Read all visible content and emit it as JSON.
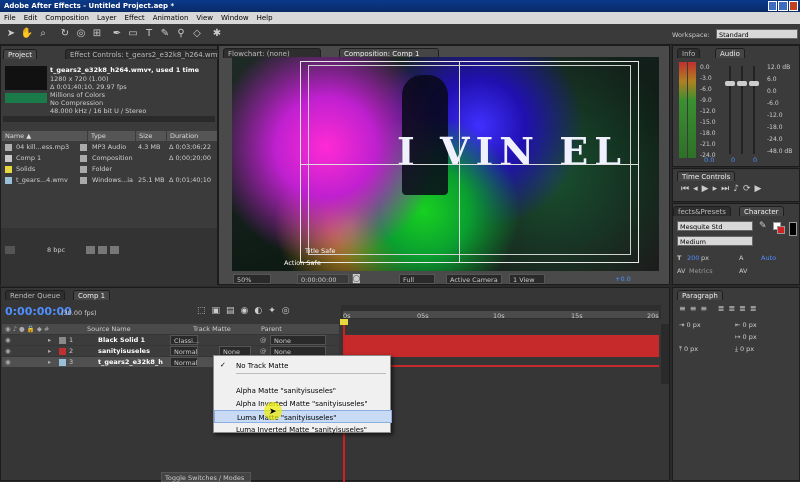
{
  "window": {
    "title": "Adobe After Effects - Untitled Project.aep *"
  },
  "menu": [
    "File",
    "Edit",
    "Composition",
    "Layer",
    "Effect",
    "Animation",
    "View",
    "Window",
    "Help"
  ],
  "workspace": {
    "label": "Workspace:",
    "value": "Standard"
  },
  "project": {
    "tab": "Project",
    "effect_tab": "Effect Controls: t_gears2_e32k8_h264.wmv",
    "name": "t_gears2_e32k8_h264.wmv▾, used 1 time",
    "info": [
      "1280 x 720 (1.00)",
      "Δ 0;01;40;10, 29.97 fps",
      "Millions of Colors",
      "No Compression",
      "48.000 kHz / 16 bit U / Stereo"
    ],
    "headers": {
      "name": "Name",
      "type": "Type",
      "size": "Size",
      "duration": "Duration"
    },
    "items": [
      {
        "name": "04 kill...ess.mp3",
        "type": "MP3 Audio",
        "size": "4.3 MB",
        "duration": "Δ 0;03;06;22",
        "color": "#b0b0b0"
      },
      {
        "name": "Comp 1",
        "type": "Composition",
        "size": "",
        "duration": "Δ 0;00;20;00",
        "color": "#c8c8c8"
      },
      {
        "name": "Solids",
        "type": "Folder",
        "size": "",
        "duration": "",
        "color": "#e6d840"
      },
      {
        "name": "t_gears...4.wmv",
        "type": "Windows...ia",
        "size": "25.1 MB",
        "duration": "Δ 0;01;40;10",
        "color": "#9ac0d8"
      }
    ],
    "bpc": "8 bpc"
  },
  "viewer": {
    "flowchart_tab": "Flowchart: (none)",
    "comp_tab": "Composition: Comp 1",
    "title_safe": "Title Safe",
    "action_safe": "Action Safe",
    "comp_text": "I VIN EL",
    "zoom": "50%",
    "timecode": "0:00:00:00",
    "resolution": "Full",
    "camera": "Active Camera",
    "views": "1 View",
    "exposure": "+0.0"
  },
  "info": {
    "tab": "Info",
    "audio_tab": "Audio"
  },
  "audio": {
    "db": [
      "0.0",
      "-3.0",
      "-6.0",
      "-9.0",
      "-12.0",
      "-15.0",
      "-18.0",
      "-21.0",
      "-24.0"
    ],
    "db_right": [
      "12.0 dB",
      "6.0",
      "0.0",
      "-6.0",
      "-12.0",
      "-18.0",
      "-24.0",
      "-48.0 dB"
    ],
    "left_val": "0.0",
    "mid_val": "0",
    "right_val": "0"
  },
  "time_controls": {
    "tab": "Time Controls"
  },
  "effects": {
    "tab": "fects&Presets",
    "character_tab": "Character",
    "font": "Mesquite Std",
    "style": "Medium",
    "size": "200",
    "size_unit": "px",
    "leading": "Auto",
    "kerning": "Metrics"
  },
  "paragraph": {
    "tab": "Paragraph",
    "values": [
      "0 px",
      "0 px",
      "0 px",
      "0 px",
      "0 px"
    ]
  },
  "timeline": {
    "render_tab": "Render Queue",
    "comp_tab": "Comp 1",
    "timecode": "0:00:00:00",
    "fps": "(30.00 fps)",
    "headers": {
      "source": "Source Name",
      "matte": "Track Matte",
      "parent": "Parent"
    },
    "ruler": [
      "0s",
      "05s",
      "10s",
      "15s",
      "20s"
    ],
    "layers": [
      {
        "num": "1",
        "name": "Black Solid 1",
        "mode": "Classi...",
        "matte": "",
        "parent": "None",
        "color": "#8a8a8a"
      },
      {
        "num": "2",
        "name": "sanityisuseles",
        "mode": "Normal",
        "matte": "None",
        "parent": "None",
        "color": "#c03030"
      },
      {
        "num": "3",
        "name": "t_gears2_e32k8_h",
        "mode": "Normal",
        "matte": "",
        "parent": "None",
        "color": "#9ac0d8"
      }
    ],
    "toggle": "Toggle Switches / Modes"
  },
  "matte_menu": {
    "items": [
      "No Track Matte",
      "Alpha Matte \"sanityisuseles\"",
      "Alpha Inverted Matte \"sanityisuseles\"",
      "Luma Matte \"sanityisuseles\"",
      "Luma Inverted Matte \"sanityisuseles\""
    ],
    "checked_index": 0,
    "hover_index": 3
  }
}
